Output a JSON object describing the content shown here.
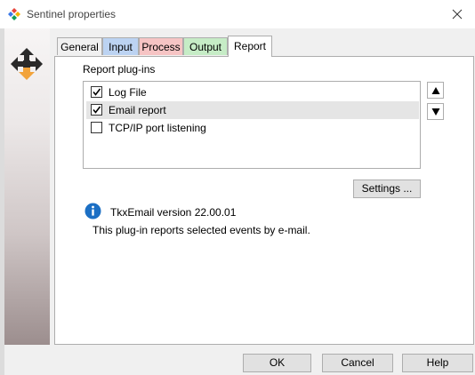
{
  "window": {
    "title": "Sentinel properties",
    "app_icon": "colored-diamond-icon",
    "close_icon": "close-icon"
  },
  "side_panel": {
    "icon": "sentinel-arrows-icon"
  },
  "tabs": [
    {
      "label": "General",
      "color": "#f0f0f0"
    },
    {
      "label": "Input",
      "color": "#bcd3f2"
    },
    {
      "label": "Process",
      "color": "#f6c4c4"
    },
    {
      "label": "Output",
      "color": "#c6ecc6"
    },
    {
      "label": "Report",
      "color": "#ffffff",
      "active": true
    }
  ],
  "report": {
    "section_label": "Report plug-ins",
    "plugins": [
      {
        "label": "Log File",
        "checked": true,
        "selected": false
      },
      {
        "label": "Email report",
        "checked": true,
        "selected": true
      },
      {
        "label": "TCP/IP port listening",
        "checked": false,
        "selected": false
      }
    ],
    "move_up_icon": "triangle-up-icon",
    "move_down_icon": "triangle-down-icon",
    "settings_label": "Settings ...",
    "info_icon": "info-icon",
    "version_text": "TkxEmail version 22.00.01",
    "description": "This plug-in reports selected events by e-mail."
  },
  "footer": {
    "ok_label": "OK",
    "cancel_label": "Cancel",
    "help_label": "Help"
  },
  "colors": {
    "info_blue": "#1c6fc4",
    "orange_arrow": "#f2a33a"
  }
}
